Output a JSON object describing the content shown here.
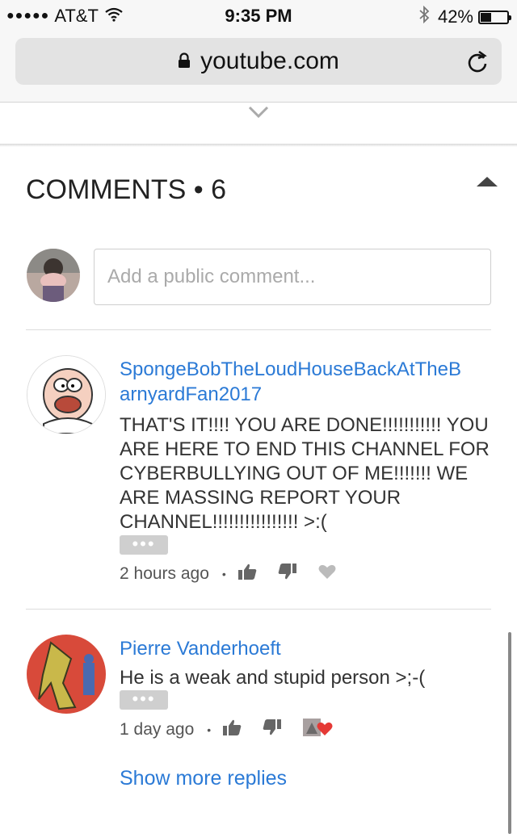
{
  "status": {
    "carrier": "AT&T",
    "time": "9:35 PM",
    "battery": "42%",
    "battery_level": 0.42
  },
  "browser": {
    "url": "youtube.com"
  },
  "comments_header": {
    "title": "COMMENTS",
    "count": "6"
  },
  "composer": {
    "placeholder": "Add a public comment..."
  },
  "comments": [
    {
      "author": "SpongeBobTheLoudHouseBackAtTheB\narnyardFan2017",
      "text": "THAT'S IT!!!! YOU ARE DONE!!!!!!!!!!! YOU ARE HERE TO END THIS CHANNEL FOR CYBERBULLYING OUT OF ME!!!!!!! WE ARE MASSING REPORT YOUR CHANNEL!!!!!!!!!!!!!!!! >:(",
      "more": "•••",
      "time": "2 hours ago"
    },
    {
      "author": "Pierre Vanderhoeft",
      "text": "He is a weak and stupid person >;-(",
      "more": "•••",
      "time": "1 day ago"
    }
  ],
  "show_more_replies": "Show more replies",
  "colors": {
    "link": "#2b7ad6",
    "text": "#333333"
  }
}
